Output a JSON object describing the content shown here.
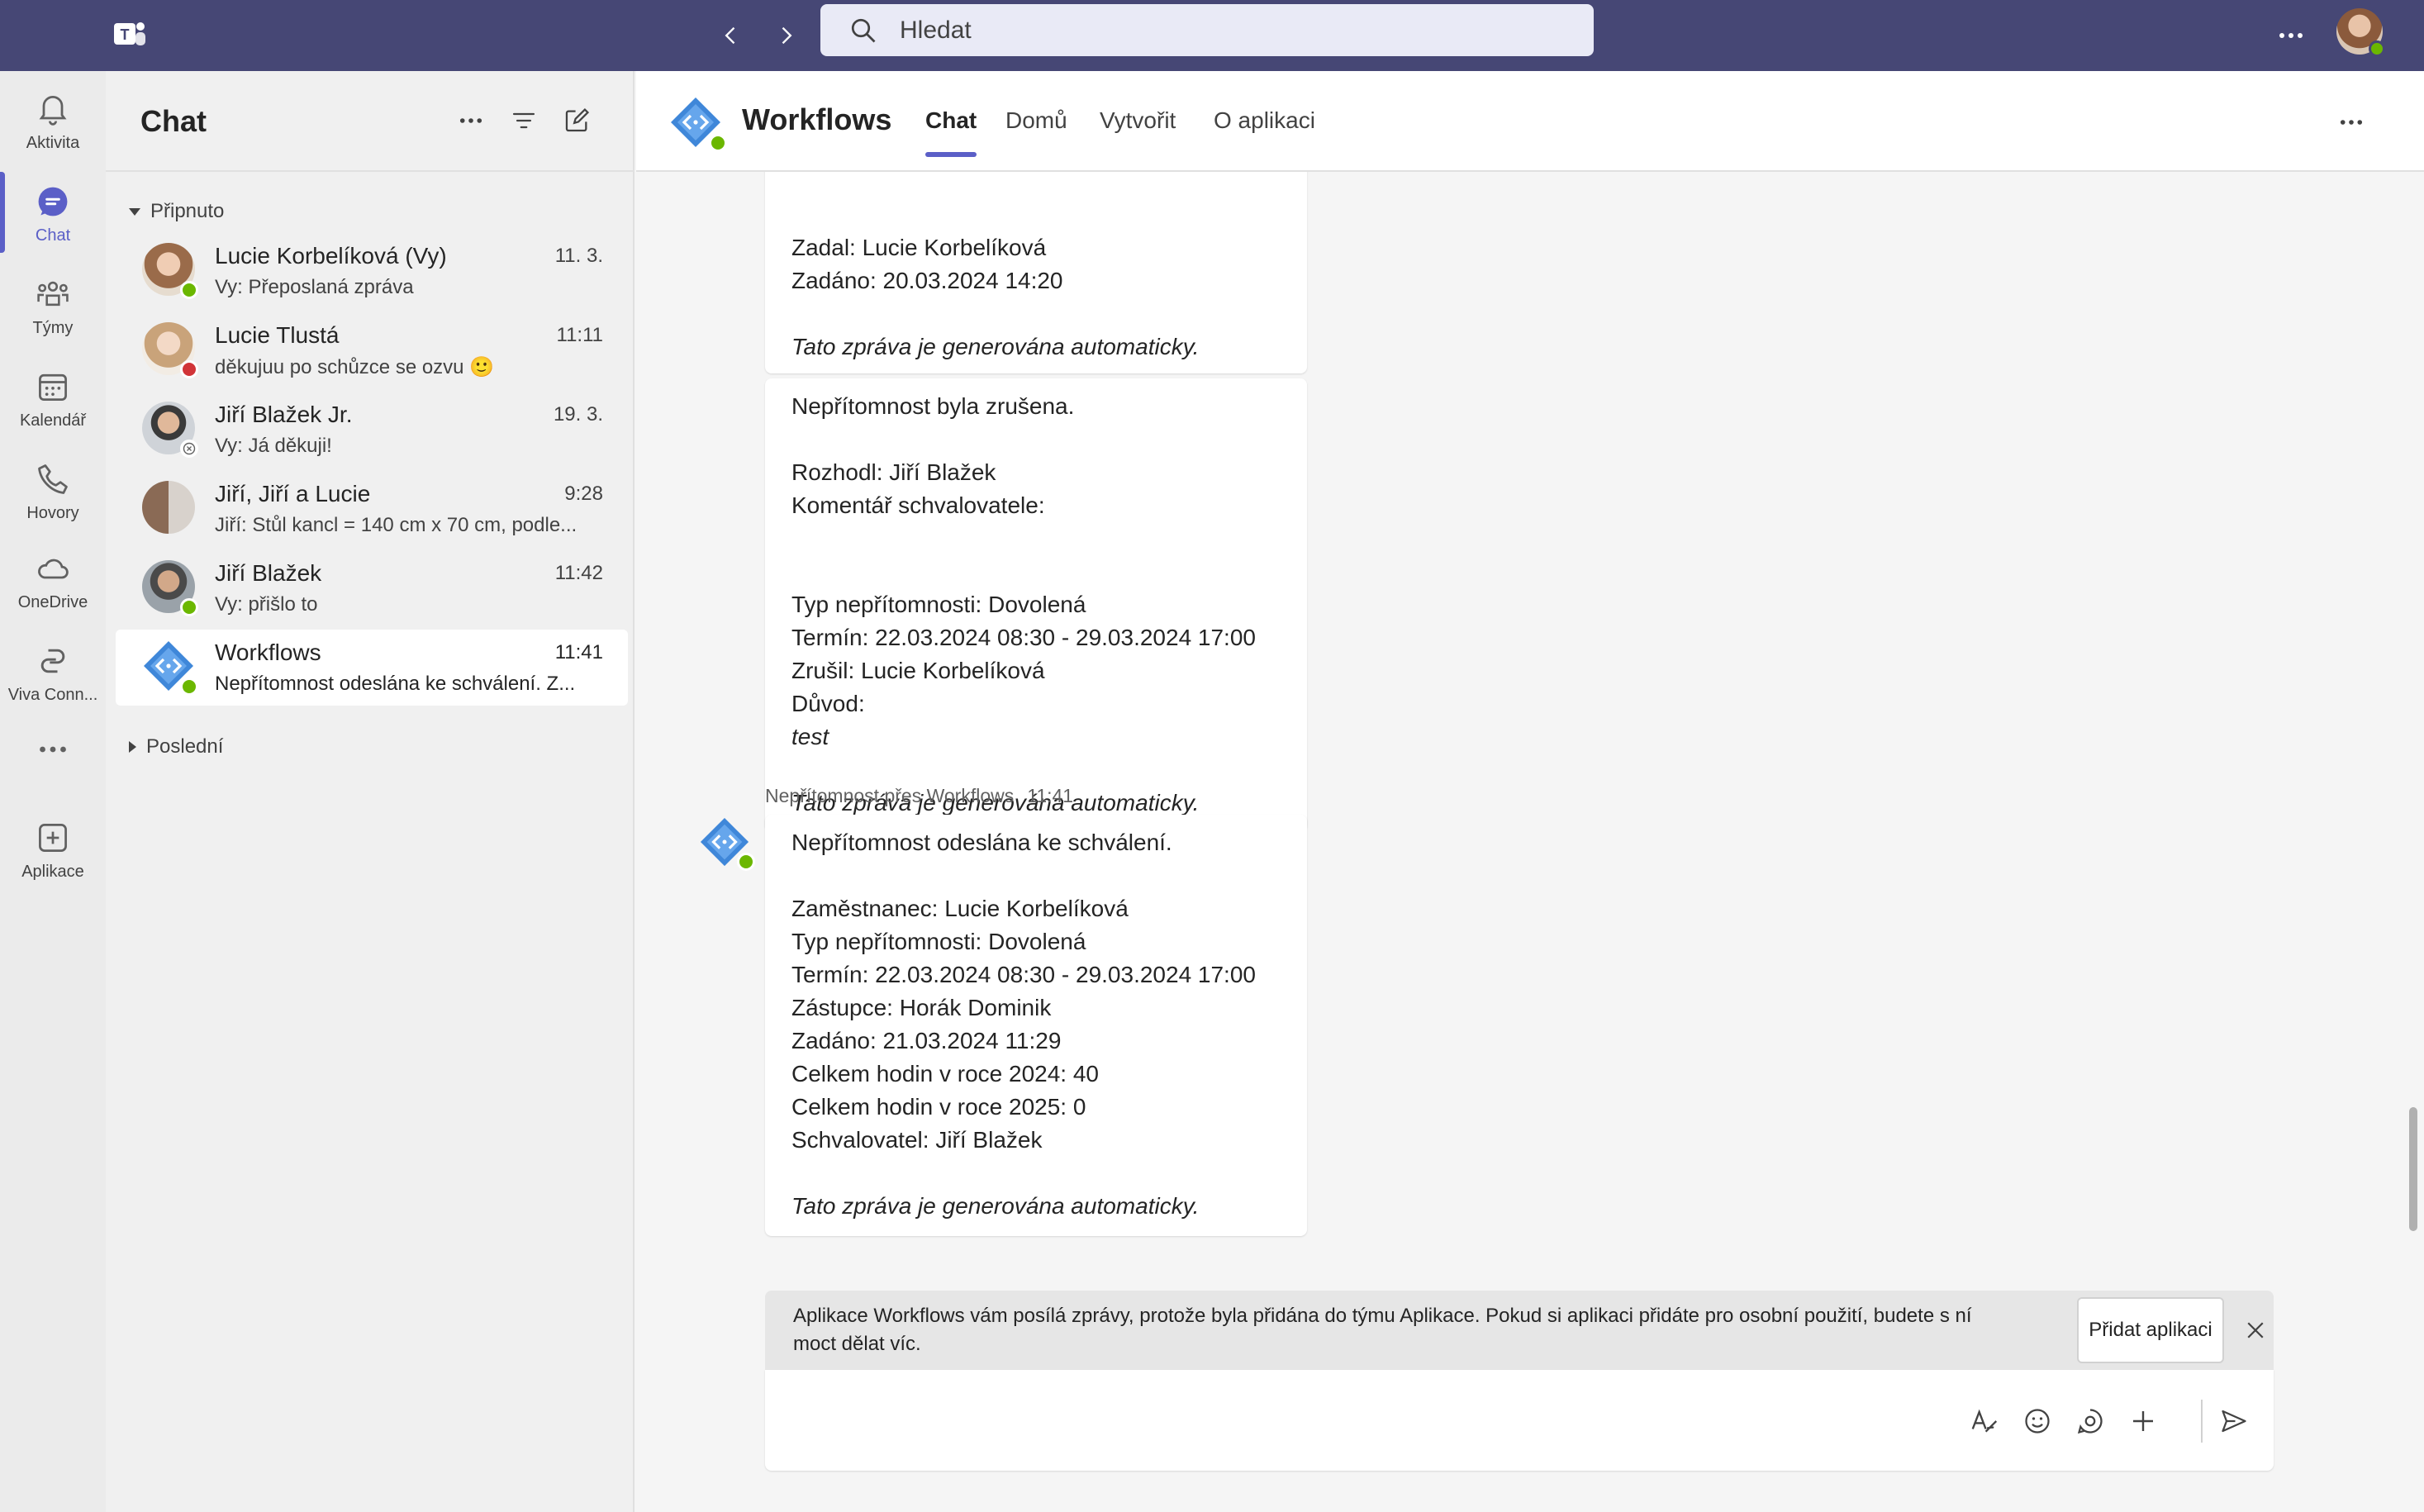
{
  "search": {
    "placeholder": "Hledat"
  },
  "rail": [
    {
      "label": "Aktivita",
      "icon": "bell-icon"
    },
    {
      "label": "Chat",
      "icon": "chat-icon",
      "active": true
    },
    {
      "label": "Týmy",
      "icon": "teams-icon"
    },
    {
      "label": "Kalendář",
      "icon": "calendar-icon"
    },
    {
      "label": "Hovory",
      "icon": "phone-icon"
    },
    {
      "label": "OneDrive",
      "icon": "cloud-icon"
    },
    {
      "label": "Viva Conn...",
      "icon": "viva-icon"
    },
    {
      "label": "Aplikace",
      "icon": "add-app-icon"
    }
  ],
  "chatlist": {
    "title": "Chat",
    "pinned_label": "Připnuto",
    "recent_label": "Poslední",
    "items": [
      {
        "name": "Lucie Korbelíková (Vy)",
        "time": "11. 3.",
        "preview": "Vy: Přeposlaná zpráva",
        "status": "available"
      },
      {
        "name": "Lucie Tlustá",
        "time": "11:11",
        "preview": "děkujuu po schůzce se ozvu 🙂",
        "status": "busy"
      },
      {
        "name": "Jiří Blažek Jr.",
        "time": "19. 3.",
        "preview": "Vy: Já děkuji!",
        "status": "offline"
      },
      {
        "name": "Jiří, Jiří a Lucie",
        "time": "9:28",
        "preview": "Jiří: Stůl kancl = 140 cm x 70 cm, podle...",
        "status": "none"
      },
      {
        "name": "Jiří Blažek",
        "time": "11:42",
        "preview": "Vy: přišlo to",
        "status": "available"
      },
      {
        "name": "Workflows",
        "time": "11:41",
        "preview": "Nepřítomnost odeslána ke schválení. Z...",
        "status": "available",
        "selected": true
      }
    ]
  },
  "main": {
    "title": "Workflows",
    "tabs": [
      "Chat",
      "Domů",
      "Vytvořit",
      "O aplikaci"
    ],
    "messages": [
      {
        "lines": [
          "Zadal: Lucie Korbelíková",
          "Zadáno: 20.03.2024 14:20",
          "",
          "Tato zpráva je generována automaticky."
        ]
      },
      {
        "lines": [
          "Nepřítomnost byla zrušena.",
          "",
          "Rozhodl: Jiří Blažek",
          "Komentář schvalovatele:",
          "",
          "",
          "Typ nepřítomnosti: Dovolená",
          "Termín: 22.03.2024 08:30 - 29.03.2024 17:00",
          "Zrušil: Lucie Korbelíková",
          "Důvod:",
          "test",
          "",
          "Tato zpráva je generována automaticky."
        ]
      },
      {
        "sender": "Nepřítomnost přes Workflows",
        "time": "11:41",
        "lines": [
          "Nepřítomnost odeslána ke schválení.",
          "",
          "Zaměstnanec: Lucie Korbelíková",
          "Typ nepřítomnosti: Dovolená",
          "Termín: 22.03.2024 08:30 - 29.03.2024 17:00",
          "Zástupce: Horák Dominik",
          "Zadáno: 21.03.2024 11:29",
          "Celkem hodin v roce 2024: 40",
          "Celkem hodin v roce 2025: 0",
          "Schvalovatel: Jiří Blažek",
          "",
          "Tato zpráva je generována automaticky."
        ]
      }
    ],
    "banner": {
      "text": "Aplikace Workflows vám posílá zprávy, protože byla přidána do týmu Aplikace. Pokud si aplikaci přidáte pro osobní použití, budete s ní moct dělat víc.",
      "button": "Přidat aplikaci"
    }
  },
  "colors": {
    "topbar": "#464775",
    "accent": "#5b5fc7",
    "available": "#6bb700",
    "busy": "#d13438"
  }
}
